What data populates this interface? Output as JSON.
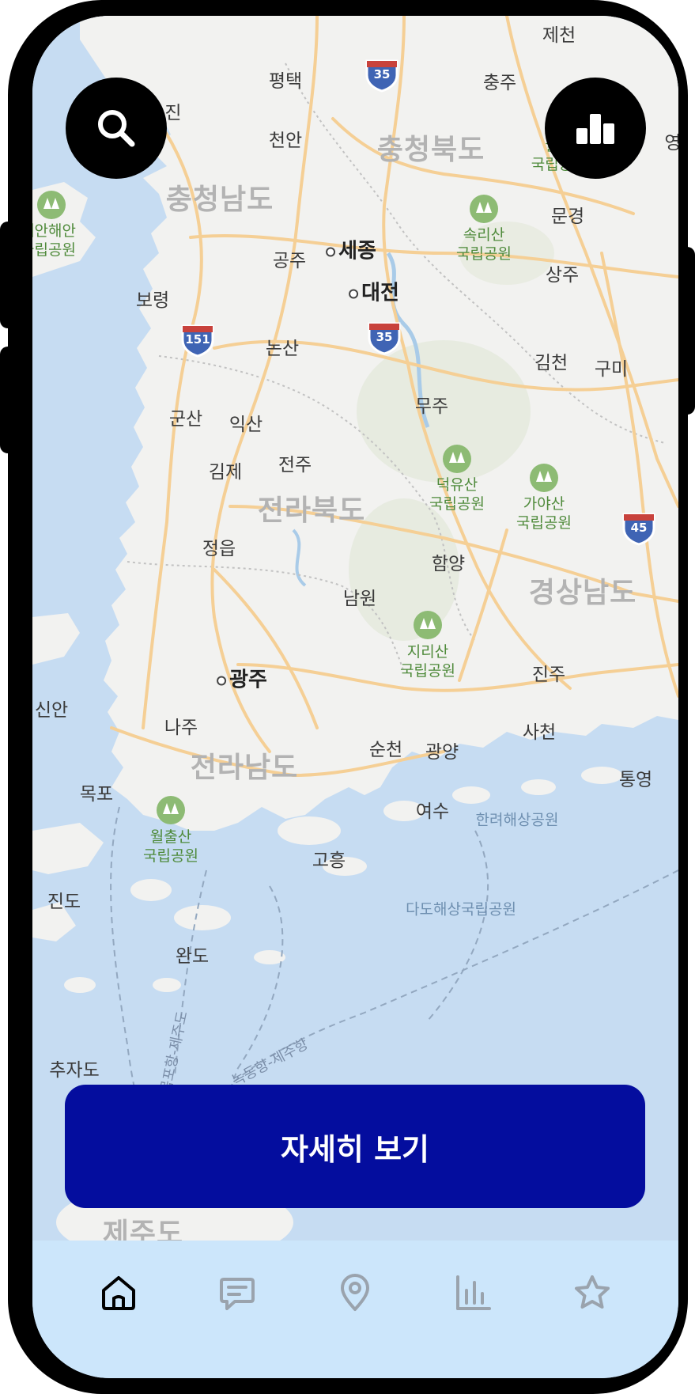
{
  "map": {
    "provinces": [
      "충청남도",
      "충청북도",
      "전라북도",
      "전라남도",
      "경상남도",
      "제주도"
    ],
    "big_cities": [
      "세종",
      "대전",
      "광주"
    ],
    "cities": [
      "제천",
      "평택",
      "충주",
      "진",
      "천안",
      "문경",
      "공주",
      "상주",
      "보령",
      "논산",
      "김천",
      "구미",
      "무주",
      "군산",
      "익산",
      "전주",
      "김제",
      "정읍",
      "함양",
      "남원",
      "진주",
      "신안",
      "나주",
      "사천",
      "순천",
      "광양",
      "목포",
      "통영",
      "여수",
      "고흥",
      "진도",
      "완도",
      "추자도",
      "영"
    ],
    "parks": [
      {
        "name": "속리산\n국립공원"
      },
      {
        "name": "덕유산\n국립공원"
      },
      {
        "name": "가야산\n국립공원"
      },
      {
        "name": "지리산\n국립공원"
      },
      {
        "name": "월출산\n국립공원"
      },
      {
        "name": "태안해안\n국립공원"
      },
      {
        "name": "월\n국립공"
      }
    ],
    "sea_parks": [
      "한려해상공원",
      "다도해상국립공원"
    ],
    "ferry_routes": [
      "목포항-제주도",
      "녹동항-제주항"
    ],
    "highways": [
      "35",
      "35",
      "151",
      "45"
    ]
  },
  "buttons": {
    "search_icon": "search-icon",
    "stats_icon": "bar-chart-icon",
    "cta_label": "자세히 보기"
  },
  "nav": {
    "items": [
      "home-icon",
      "chat-icon",
      "location-pin-icon",
      "bar-chart-icon",
      "star-icon"
    ],
    "active_color": "#000000",
    "inactive_color": "#9aa3ad"
  },
  "colors": {
    "sea": "#c6dcf2",
    "land": "#f2f2f0",
    "road": "#f5cf95",
    "cta": "#040d9e",
    "nav_bg": "#cce6fb"
  }
}
